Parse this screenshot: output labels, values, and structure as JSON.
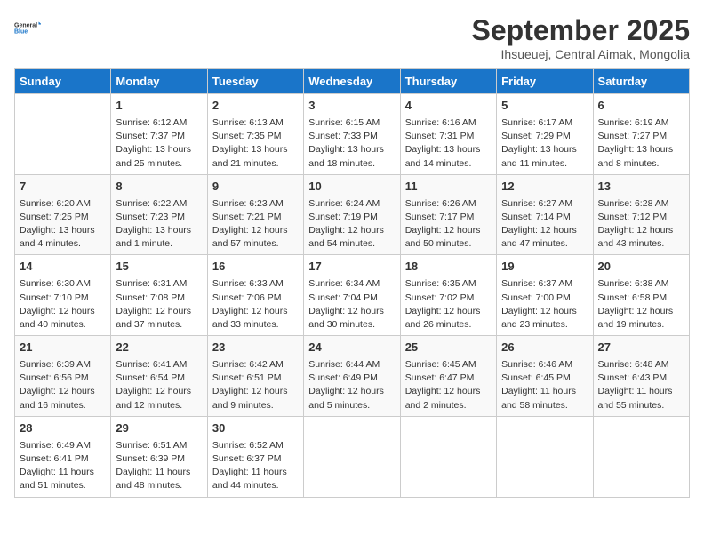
{
  "logo": {
    "line1": "General",
    "line2": "Blue"
  },
  "title": "September 2025",
  "subtitle": "Ihsueuej, Central Aimak, Mongolia",
  "days_of_week": [
    "Sunday",
    "Monday",
    "Tuesday",
    "Wednesday",
    "Thursday",
    "Friday",
    "Saturday"
  ],
  "weeks": [
    [
      {
        "day": "",
        "content": ""
      },
      {
        "day": "1",
        "content": "Sunrise: 6:12 AM\nSunset: 7:37 PM\nDaylight: 13 hours\nand 25 minutes."
      },
      {
        "day": "2",
        "content": "Sunrise: 6:13 AM\nSunset: 7:35 PM\nDaylight: 13 hours\nand 21 minutes."
      },
      {
        "day": "3",
        "content": "Sunrise: 6:15 AM\nSunset: 7:33 PM\nDaylight: 13 hours\nand 18 minutes."
      },
      {
        "day": "4",
        "content": "Sunrise: 6:16 AM\nSunset: 7:31 PM\nDaylight: 13 hours\nand 14 minutes."
      },
      {
        "day": "5",
        "content": "Sunrise: 6:17 AM\nSunset: 7:29 PM\nDaylight: 13 hours\nand 11 minutes."
      },
      {
        "day": "6",
        "content": "Sunrise: 6:19 AM\nSunset: 7:27 PM\nDaylight: 13 hours\nand 8 minutes."
      }
    ],
    [
      {
        "day": "7",
        "content": "Sunrise: 6:20 AM\nSunset: 7:25 PM\nDaylight: 13 hours\nand 4 minutes."
      },
      {
        "day": "8",
        "content": "Sunrise: 6:22 AM\nSunset: 7:23 PM\nDaylight: 13 hours\nand 1 minute."
      },
      {
        "day": "9",
        "content": "Sunrise: 6:23 AM\nSunset: 7:21 PM\nDaylight: 12 hours\nand 57 minutes."
      },
      {
        "day": "10",
        "content": "Sunrise: 6:24 AM\nSunset: 7:19 PM\nDaylight: 12 hours\nand 54 minutes."
      },
      {
        "day": "11",
        "content": "Sunrise: 6:26 AM\nSunset: 7:17 PM\nDaylight: 12 hours\nand 50 minutes."
      },
      {
        "day": "12",
        "content": "Sunrise: 6:27 AM\nSunset: 7:14 PM\nDaylight: 12 hours\nand 47 minutes."
      },
      {
        "day": "13",
        "content": "Sunrise: 6:28 AM\nSunset: 7:12 PM\nDaylight: 12 hours\nand 43 minutes."
      }
    ],
    [
      {
        "day": "14",
        "content": "Sunrise: 6:30 AM\nSunset: 7:10 PM\nDaylight: 12 hours\nand 40 minutes."
      },
      {
        "day": "15",
        "content": "Sunrise: 6:31 AM\nSunset: 7:08 PM\nDaylight: 12 hours\nand 37 minutes."
      },
      {
        "day": "16",
        "content": "Sunrise: 6:33 AM\nSunset: 7:06 PM\nDaylight: 12 hours\nand 33 minutes."
      },
      {
        "day": "17",
        "content": "Sunrise: 6:34 AM\nSunset: 7:04 PM\nDaylight: 12 hours\nand 30 minutes."
      },
      {
        "day": "18",
        "content": "Sunrise: 6:35 AM\nSunset: 7:02 PM\nDaylight: 12 hours\nand 26 minutes."
      },
      {
        "day": "19",
        "content": "Sunrise: 6:37 AM\nSunset: 7:00 PM\nDaylight: 12 hours\nand 23 minutes."
      },
      {
        "day": "20",
        "content": "Sunrise: 6:38 AM\nSunset: 6:58 PM\nDaylight: 12 hours\nand 19 minutes."
      }
    ],
    [
      {
        "day": "21",
        "content": "Sunrise: 6:39 AM\nSunset: 6:56 PM\nDaylight: 12 hours\nand 16 minutes."
      },
      {
        "day": "22",
        "content": "Sunrise: 6:41 AM\nSunset: 6:54 PM\nDaylight: 12 hours\nand 12 minutes."
      },
      {
        "day": "23",
        "content": "Sunrise: 6:42 AM\nSunset: 6:51 PM\nDaylight: 12 hours\nand 9 minutes."
      },
      {
        "day": "24",
        "content": "Sunrise: 6:44 AM\nSunset: 6:49 PM\nDaylight: 12 hours\nand 5 minutes."
      },
      {
        "day": "25",
        "content": "Sunrise: 6:45 AM\nSunset: 6:47 PM\nDaylight: 12 hours\nand 2 minutes."
      },
      {
        "day": "26",
        "content": "Sunrise: 6:46 AM\nSunset: 6:45 PM\nDaylight: 11 hours\nand 58 minutes."
      },
      {
        "day": "27",
        "content": "Sunrise: 6:48 AM\nSunset: 6:43 PM\nDaylight: 11 hours\nand 55 minutes."
      }
    ],
    [
      {
        "day": "28",
        "content": "Sunrise: 6:49 AM\nSunset: 6:41 PM\nDaylight: 11 hours\nand 51 minutes."
      },
      {
        "day": "29",
        "content": "Sunrise: 6:51 AM\nSunset: 6:39 PM\nDaylight: 11 hours\nand 48 minutes."
      },
      {
        "day": "30",
        "content": "Sunrise: 6:52 AM\nSunset: 6:37 PM\nDaylight: 11 hours\nand 44 minutes."
      },
      {
        "day": "",
        "content": ""
      },
      {
        "day": "",
        "content": ""
      },
      {
        "day": "",
        "content": ""
      },
      {
        "day": "",
        "content": ""
      }
    ]
  ]
}
